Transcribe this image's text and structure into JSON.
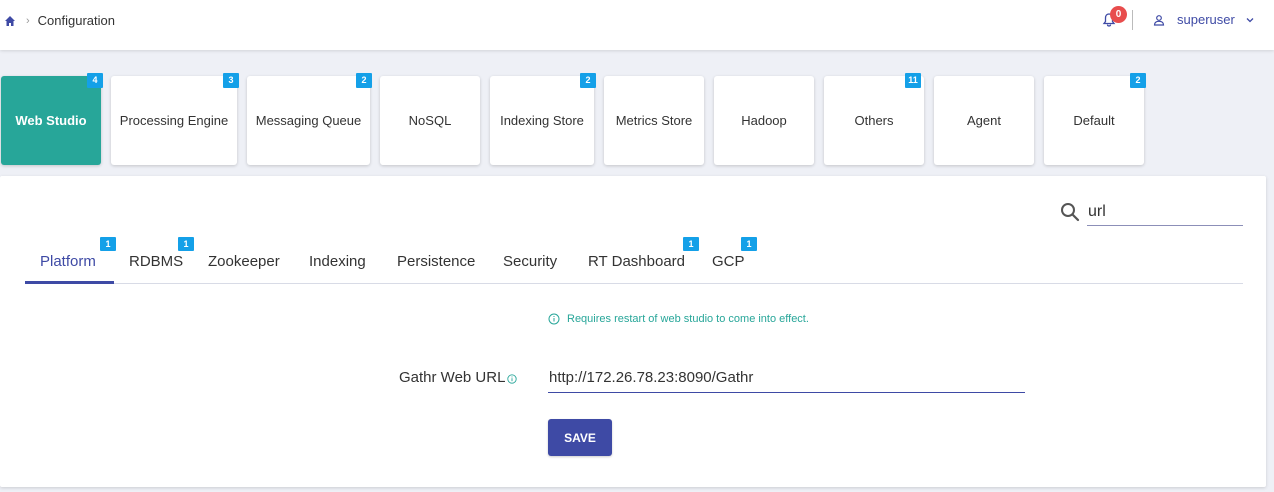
{
  "breadcrumb": {
    "current": "Configuration"
  },
  "header": {
    "notification_count": "0",
    "username": "superuser"
  },
  "categories": [
    {
      "label": "Web Studio",
      "badge": "4"
    },
    {
      "label": "Processing Engine",
      "badge": "3"
    },
    {
      "label": "Messaging Queue",
      "badge": "2"
    },
    {
      "label": "NoSQL",
      "badge": ""
    },
    {
      "label": "Indexing Store",
      "badge": "2"
    },
    {
      "label": "Metrics Store",
      "badge": ""
    },
    {
      "label": "Hadoop",
      "badge": ""
    },
    {
      "label": "Others",
      "badge": "11"
    },
    {
      "label": "Agent",
      "badge": ""
    },
    {
      "label": "Default",
      "badge": "2"
    }
  ],
  "search": {
    "value": "url"
  },
  "tabs": [
    {
      "label": "Platform",
      "badge": "1"
    },
    {
      "label": "RDBMS",
      "badge": "1"
    },
    {
      "label": "Zookeeper",
      "badge": ""
    },
    {
      "label": "Indexing",
      "badge": ""
    },
    {
      "label": "Persistence",
      "badge": ""
    },
    {
      "label": "Security",
      "badge": ""
    },
    {
      "label": "RT Dashboard",
      "badge": "1"
    },
    {
      "label": "GCP",
      "badge": "1"
    }
  ],
  "notice": "Requires restart of web studio to come into effect.",
  "form": {
    "field_label": "Gathr Web URL",
    "field_value": "http://172.26.78.23:8090/Gathr",
    "save_label": "SAVE"
  },
  "colors": {
    "accent": "#3e4aa5",
    "active_card": "#27a699",
    "badge": "#14a0e8",
    "alert": "#e84d4d"
  }
}
